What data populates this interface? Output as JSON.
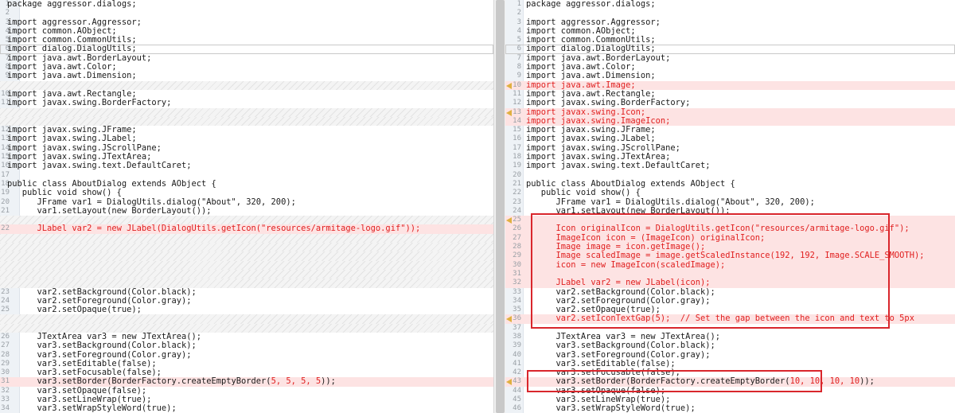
{
  "left": [
    {
      "n": "1",
      "t": "package aggressor.dialogs;",
      "k": ""
    },
    {
      "n": "2",
      "t": "",
      "k": ""
    },
    {
      "n": "3",
      "t": "import aggressor.Aggressor;",
      "k": ""
    },
    {
      "n": "4",
      "t": "import common.AObject;",
      "k": ""
    },
    {
      "n": "5",
      "t": "import common.CommonUtils;",
      "k": ""
    },
    {
      "n": "6",
      "t": "import dialog.DialogUtils;",
      "k": "boxed"
    },
    {
      "n": "7",
      "t": "import java.awt.BorderLayout;",
      "k": ""
    },
    {
      "n": "8",
      "t": "import java.awt.Color;",
      "k": ""
    },
    {
      "n": "9",
      "t": "import java.awt.Dimension;",
      "k": ""
    },
    {
      "n": "",
      "t": "",
      "k": "gap"
    },
    {
      "n": "10",
      "t": "import java.awt.Rectangle;",
      "k": ""
    },
    {
      "n": "11",
      "t": "import javax.swing.BorderFactory;",
      "k": ""
    },
    {
      "n": "",
      "t": "",
      "k": "gap"
    },
    {
      "n": "",
      "t": "",
      "k": "gap"
    },
    {
      "n": "12",
      "t": "import javax.swing.JFrame;",
      "k": ""
    },
    {
      "n": "13",
      "t": "import javax.swing.JLabel;",
      "k": ""
    },
    {
      "n": "14",
      "t": "import javax.swing.JScrollPane;",
      "k": ""
    },
    {
      "n": "15",
      "t": "import javax.swing.JTextArea;",
      "k": ""
    },
    {
      "n": "16",
      "t": "import javax.swing.text.DefaultCaret;",
      "k": ""
    },
    {
      "n": "17",
      "t": "",
      "k": ""
    },
    {
      "n": "18",
      "t": "public class AboutDialog extends AObject {",
      "k": ""
    },
    {
      "n": "19",
      "t": "   public void show() {",
      "k": ""
    },
    {
      "n": "20",
      "t": "      JFrame var1 = DialogUtils.dialog(\"About\", 320, 200);",
      "k": ""
    },
    {
      "n": "21",
      "t": "      var1.setLayout(new BorderLayout());",
      "k": ""
    },
    {
      "n": "",
      "t": "",
      "k": "gap"
    },
    {
      "n": "22",
      "t": "      JLabel var2 = new JLabel(DialogUtils.getIcon(\"resources/armitage-logo.gif\"));",
      "k": "changed"
    },
    {
      "n": "",
      "t": "",
      "k": "gap"
    },
    {
      "n": "",
      "t": "",
      "k": "gap"
    },
    {
      "n": "",
      "t": "",
      "k": "gap"
    },
    {
      "n": "",
      "t": "",
      "k": "gap"
    },
    {
      "n": "",
      "t": "",
      "k": "gap"
    },
    {
      "n": "",
      "t": "",
      "k": "gap"
    },
    {
      "n": "23",
      "t": "      var2.setBackground(Color.black);",
      "k": ""
    },
    {
      "n": "24",
      "t": "      var2.setForeground(Color.gray);",
      "k": ""
    },
    {
      "n": "25",
      "t": "      var2.setOpaque(true);",
      "k": ""
    },
    {
      "n": "",
      "t": "",
      "k": "gap"
    },
    {
      "n": "",
      "t": "",
      "k": "gap"
    },
    {
      "n": "26",
      "t": "      JTextArea var3 = new JTextArea();",
      "k": ""
    },
    {
      "n": "27",
      "t": "      var3.setBackground(Color.black);",
      "k": ""
    },
    {
      "n": "28",
      "t": "      var3.setForeground(Color.gray);",
      "k": ""
    },
    {
      "n": "29",
      "t": "      var3.setEditable(false);",
      "k": ""
    },
    {
      "n": "30",
      "t": "      var3.setFocusable(false);",
      "k": ""
    },
    {
      "n": "31",
      "t": "      var3.setBorder(BorderFactory.createEmptyBorder(5, 5, 5, 5));",
      "k": "changed-partial",
      "h": "5, 5, 5, 5"
    },
    {
      "n": "32",
      "t": "      var3.setOpaque(false);",
      "k": ""
    },
    {
      "n": "33",
      "t": "      var3.setLineWrap(true);",
      "k": ""
    },
    {
      "n": "34",
      "t": "      var3.setWrapStyleWord(true);",
      "k": ""
    }
  ],
  "right": [
    {
      "n": "1",
      "t": "package aggressor.dialogs;",
      "k": ""
    },
    {
      "n": "2",
      "t": "",
      "k": ""
    },
    {
      "n": "3",
      "t": "import aggressor.Aggressor;",
      "k": ""
    },
    {
      "n": "4",
      "t": "import common.AObject;",
      "k": ""
    },
    {
      "n": "5",
      "t": "import common.CommonUtils;",
      "k": ""
    },
    {
      "n": "6",
      "t": "import dialog.DialogUtils;",
      "k": "boxed"
    },
    {
      "n": "7",
      "t": "import java.awt.BorderLayout;",
      "k": ""
    },
    {
      "n": "8",
      "t": "import java.awt.Color;",
      "k": ""
    },
    {
      "n": "9",
      "t": "import java.awt.Dimension;",
      "k": ""
    },
    {
      "n": "10",
      "t": "import java.awt.Image;",
      "k": "changed",
      "m": true
    },
    {
      "n": "11",
      "t": "import java.awt.Rectangle;",
      "k": ""
    },
    {
      "n": "12",
      "t": "import javax.swing.BorderFactory;",
      "k": ""
    },
    {
      "n": "13",
      "t": "import javax.swing.Icon;",
      "k": "changed",
      "m": true
    },
    {
      "n": "14",
      "t": "import javax.swing.ImageIcon;",
      "k": "changed"
    },
    {
      "n": "15",
      "t": "import javax.swing.JFrame;",
      "k": ""
    },
    {
      "n": "16",
      "t": "import javax.swing.JLabel;",
      "k": ""
    },
    {
      "n": "17",
      "t": "import javax.swing.JScrollPane;",
      "k": ""
    },
    {
      "n": "18",
      "t": "import javax.swing.JTextArea;",
      "k": ""
    },
    {
      "n": "19",
      "t": "import javax.swing.text.DefaultCaret;",
      "k": ""
    },
    {
      "n": "20",
      "t": "",
      "k": ""
    },
    {
      "n": "21",
      "t": "public class AboutDialog extends AObject {",
      "k": ""
    },
    {
      "n": "22",
      "t": "   public void show() {",
      "k": ""
    },
    {
      "n": "23",
      "t": "      JFrame var1 = DialogUtils.dialog(\"About\", 320, 200);",
      "k": ""
    },
    {
      "n": "24",
      "t": "      var1.setLayout(new BorderLayout());",
      "k": ""
    },
    {
      "n": "25",
      "t": "",
      "k": "changed",
      "m": true
    },
    {
      "n": "26",
      "t": "      Icon originalIcon = DialogUtils.getIcon(\"resources/armitage-logo.gif\");",
      "k": "changed"
    },
    {
      "n": "27",
      "t": "      ImageIcon icon = (ImageIcon) originalIcon;",
      "k": "changed"
    },
    {
      "n": "28",
      "t": "      Image image = icon.getImage();",
      "k": "changed"
    },
    {
      "n": "29",
      "t": "      Image scaledImage = image.getScaledInstance(192, 192, Image.SCALE_SMOOTH);",
      "k": "changed"
    },
    {
      "n": "30",
      "t": "      icon = new ImageIcon(scaledImage);",
      "k": "changed"
    },
    {
      "n": "31",
      "t": "",
      "k": "changed"
    },
    {
      "n": "32",
      "t": "      JLabel var2 = new JLabel(icon);",
      "k": "changed"
    },
    {
      "n": "33",
      "t": "      var2.setBackground(Color.black);",
      "k": ""
    },
    {
      "n": "34",
      "t": "      var2.setForeground(Color.gray);",
      "k": ""
    },
    {
      "n": "35",
      "t": "      var2.setOpaque(true);",
      "k": ""
    },
    {
      "n": "36",
      "t": "      var2.setIconTextGap(5);  // Set the gap between the icon and text to 5px",
      "k": "changed",
      "m": true
    },
    {
      "n": "37",
      "t": "",
      "k": ""
    },
    {
      "n": "38",
      "t": "      JTextArea var3 = new JTextArea();",
      "k": ""
    },
    {
      "n": "39",
      "t": "      var3.setBackground(Color.black);",
      "k": ""
    },
    {
      "n": "40",
      "t": "      var3.setForeground(Color.gray);",
      "k": ""
    },
    {
      "n": "41",
      "t": "      var3.setEditable(false);",
      "k": ""
    },
    {
      "n": "42",
      "t": "      var3.setFocusable(false);",
      "k": ""
    },
    {
      "n": "43",
      "t": "      var3.setBorder(BorderFactory.createEmptyBorder(10, 10, 10, 10));",
      "k": "changed-partial",
      "m": true,
      "h": "10, 10, 10, 10"
    },
    {
      "n": "44",
      "t": "      var3.setOpaque(false);",
      "k": ""
    },
    {
      "n": "45",
      "t": "      var3.setLineWrap(true);",
      "k": ""
    },
    {
      "n": "46",
      "t": "      var3.setWrapStyleWord(true);",
      "k": ""
    }
  ],
  "colors": {
    "changed_bg": "#fde3e3",
    "changed_text": "#e01e1e",
    "annotation_box": "#d9262c",
    "marker": "#e0b040"
  }
}
